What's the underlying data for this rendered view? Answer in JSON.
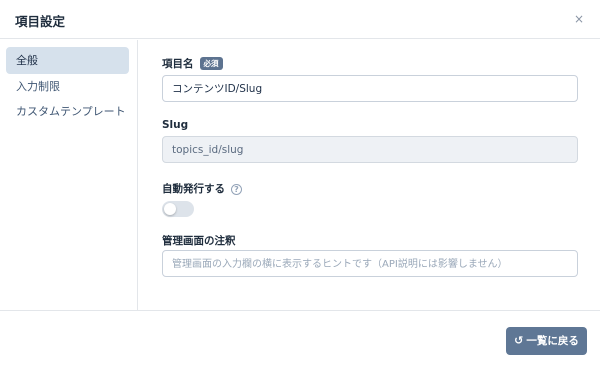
{
  "header": {
    "title": "項目設定",
    "close_symbol": "×"
  },
  "sidebar": {
    "items": [
      {
        "label": "全般",
        "active": true
      },
      {
        "label": "入力制限",
        "active": false
      },
      {
        "label": "カスタムテンプレート",
        "active": false
      }
    ]
  },
  "form": {
    "field_name": {
      "label": "項目名",
      "badge": "必須",
      "value": "コンテンツID/Slug"
    },
    "slug": {
      "label": "Slug",
      "value": "topics_id/slug"
    },
    "auto_publish": {
      "label": "自動発行する",
      "help_symbol": "?",
      "enabled": false
    },
    "admin_note": {
      "label": "管理画面の注釈",
      "placeholder": "管理画面の入力欄の横に表示するヒントです（API説明には影響しません）"
    }
  },
  "footer": {
    "back_label": "一覧に戻る",
    "back_icon_symbol": "↺"
  },
  "colors": {
    "accent": "#5f7795",
    "active_bg": "#d6e1ec",
    "badge_bg": "#5d7390"
  }
}
